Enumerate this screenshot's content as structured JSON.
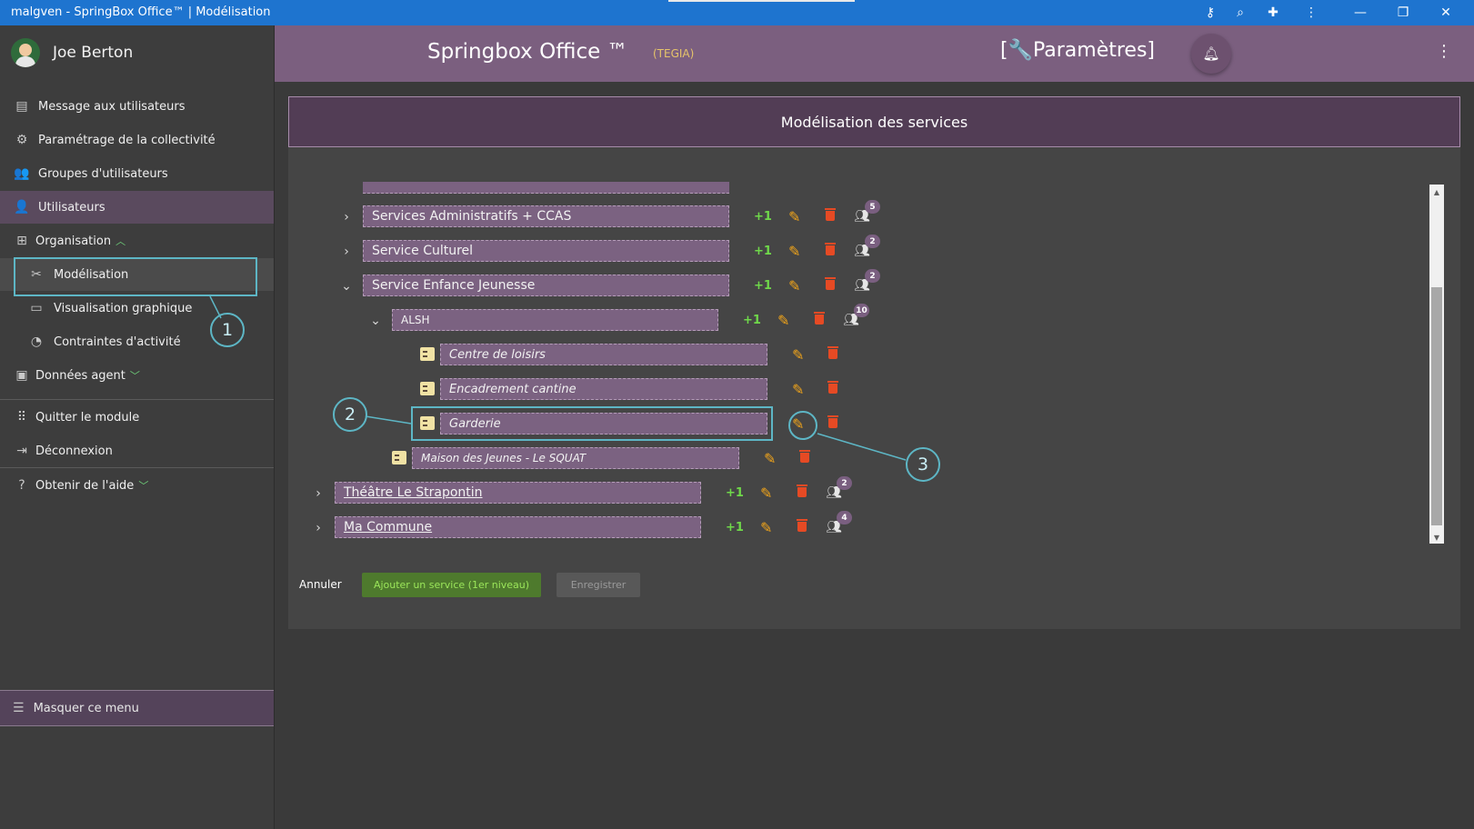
{
  "window": {
    "title": "malgven - SpringBox Office™ | Modélisation"
  },
  "sidebar": {
    "user_name": "Joe Berton",
    "items": [
      {
        "label": "Message aux utilisateurs"
      },
      {
        "label": "Paramétrage de la collectivité"
      },
      {
        "label": "Groupes d'utilisateurs"
      },
      {
        "label": "Utilisateurs"
      },
      {
        "label": "Organisation"
      },
      {
        "label": "Modélisation"
      },
      {
        "label": "Visualisation graphique"
      },
      {
        "label": "Contraintes d'activité"
      },
      {
        "label": "Données agent"
      },
      {
        "label": "Quitter le module"
      },
      {
        "label": "Déconnexion"
      },
      {
        "label": "Obtenir de l'aide"
      }
    ],
    "hide_menu": "Masquer ce menu"
  },
  "header": {
    "brand": "Springbox Office ™",
    "org": "(TEGIA)",
    "section": "[🔧Paramètres]"
  },
  "panel": {
    "title": "Modélisation des services"
  },
  "tree": {
    "plus_label": "+1",
    "rows": [
      {
        "label": "Services Administratifs + CCAS",
        "badge": "5"
      },
      {
        "label": "Service Culturel",
        "badge": "2"
      },
      {
        "label": "Service Enfance Jeunesse",
        "badge": "2"
      },
      {
        "label": "ALSH",
        "badge": "10"
      },
      {
        "label": "Centre de loisirs"
      },
      {
        "label": "Encadrement cantine"
      },
      {
        "label": "Garderie"
      },
      {
        "label": "Maison des Jeunes - Le SQUAT"
      },
      {
        "label": "Théâtre Le Strapontin",
        "badge": "2"
      },
      {
        "label": "Ma Commune",
        "badge": "4"
      }
    ]
  },
  "buttons": {
    "cancel": "Annuler",
    "add_service": "Ajouter un service (1er niveau)",
    "save": "Enregistrer"
  },
  "callouts": [
    "1",
    "2",
    "3"
  ],
  "colors": {
    "titlebar": "#1e74cf",
    "header": "#7b5f7f",
    "accent_green": "#6fd84a",
    "edit_orange": "#f2a51a",
    "delete_red": "#e64a24",
    "callout": "#5db6c5"
  }
}
